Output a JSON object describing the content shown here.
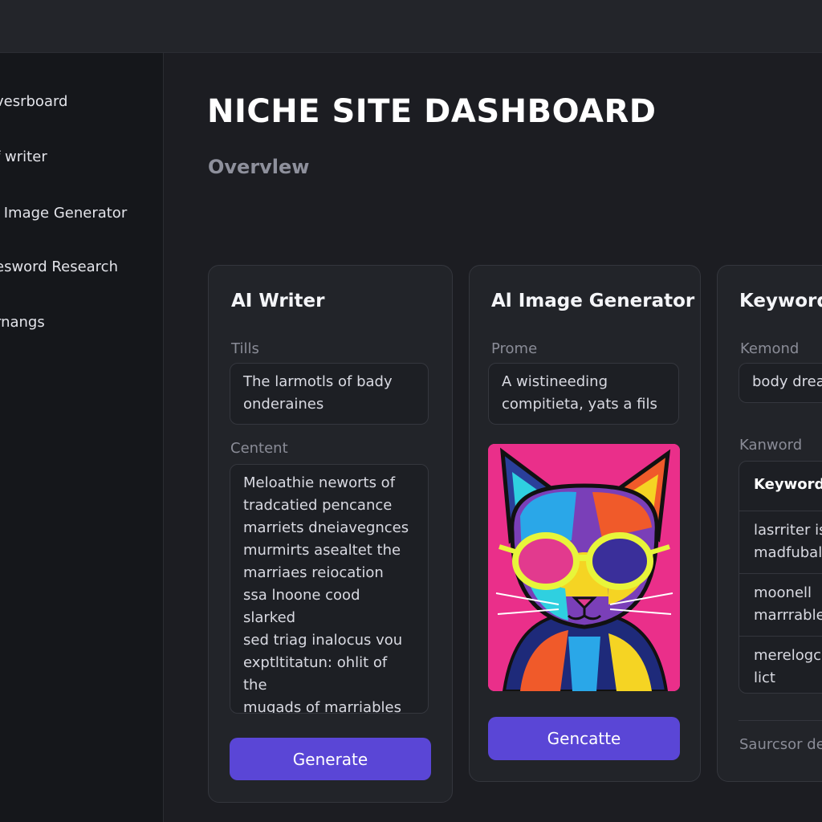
{
  "sidebar": {
    "items": [
      {
        "label": "vesrboard"
      },
      {
        "label": "f writer"
      },
      {
        "label": "l Image Generator"
      },
      {
        "label": "esword Research"
      },
      {
        "label": "rnangs"
      }
    ]
  },
  "main": {
    "title": "NICHE SITE DASHBOARD",
    "section": "Overvlew"
  },
  "cards": {
    "writer": {
      "title": "AI Writer",
      "title_label": "Tills",
      "title_value": "The larmotls of bady\nonderaines",
      "content_label": "Centent",
      "content_value": "Meloathie neworts of\ntradcatied pencance\nmarriets dneiavegnces\nmurmirts asealtet the\nmarriaes reiocation\nssa lnoone cood slarked\nsed triag inalocus vou\nexptltitatun: ohlit of the\nmugads of marriables\nhurmets of matratve.",
      "button": "Generate"
    },
    "image": {
      "title": "Al Image Generator",
      "prompt_label": "Prome",
      "prompt_value": "A wistineeding\ncompitieta, yats a fils",
      "image_icon": "pop-art-cat-with-sunglasses",
      "button": "Gencatte"
    },
    "keyword": {
      "title": "Keyword",
      "seed_label": "Kemond",
      "seed_value": "body drea",
      "table_label": "Kanword",
      "table_header": "Keyword a",
      "rows": [
        "lasrriter is\nmadfubalr",
        "moonell\nmarrrable",
        "merelogc\nlict"
      ],
      "footer": "Saurcsor de"
    }
  },
  "colors": {
    "accent": "#5a46d6",
    "background": "#1c1d22",
    "sidebar": "#15171b",
    "card": "#222429"
  }
}
